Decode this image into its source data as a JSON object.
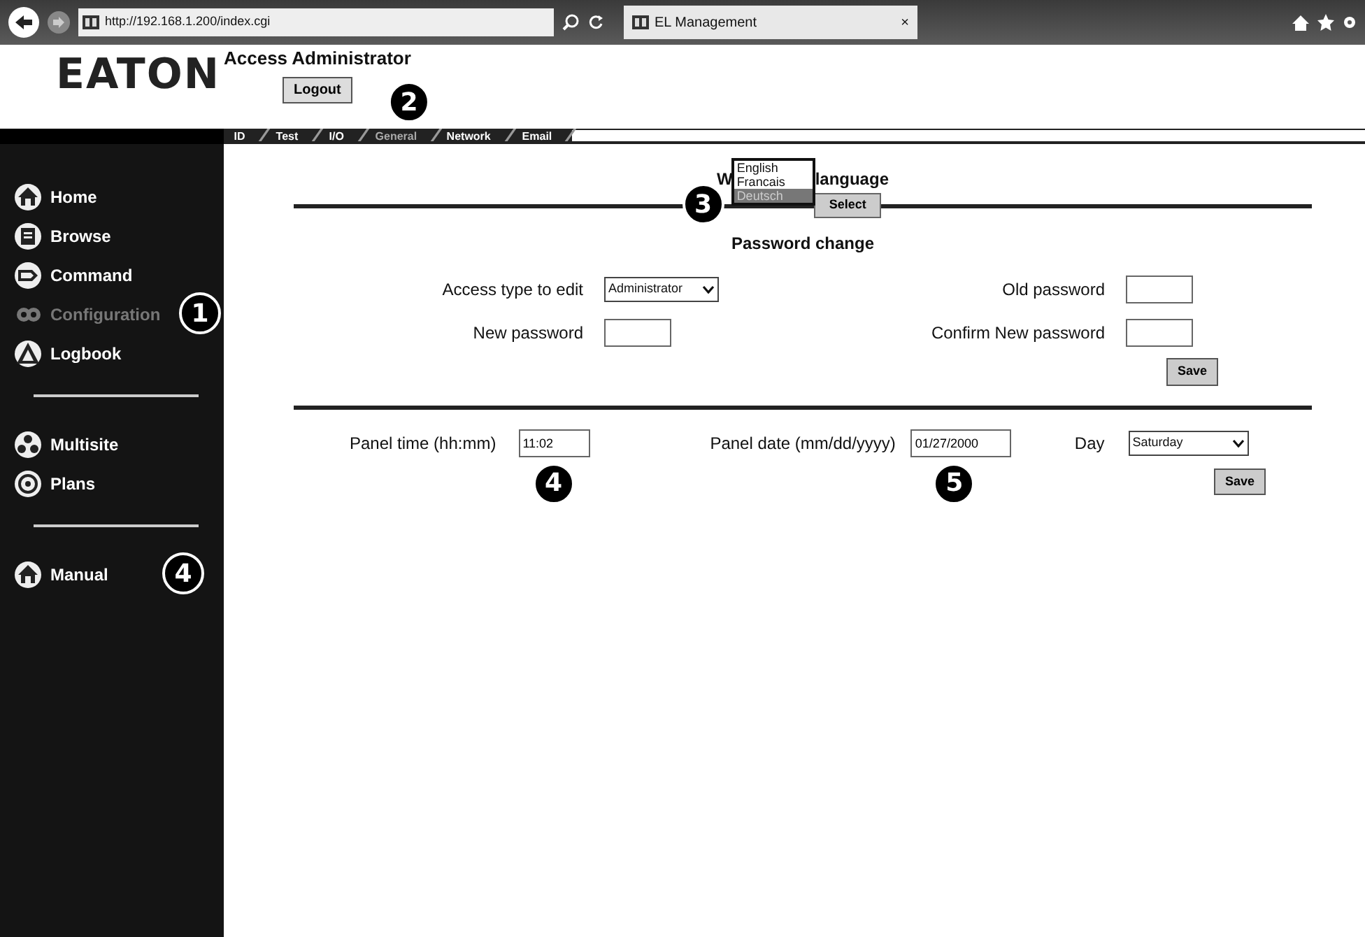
{
  "browser": {
    "address": "http://192.168.1.200/index.cgi",
    "tab_title": "EL Management",
    "tab_close": "×"
  },
  "header": {
    "logo": "EATON",
    "user_title": "Access Administrator",
    "logout": "Logout"
  },
  "tabs": [
    {
      "label": "ID",
      "selected": false
    },
    {
      "label": "Test",
      "selected": false
    },
    {
      "label": "I/O",
      "selected": false
    },
    {
      "label": "General",
      "selected": true,
      "callout": "2"
    },
    {
      "label": "Network",
      "selected": false
    },
    {
      "label": "Email",
      "selected": false
    }
  ],
  "sidebar": {
    "groups": [
      {
        "items": [
          {
            "label": "Home",
            "selected": false
          },
          {
            "label": "Browse",
            "selected": false
          },
          {
            "label": "Command",
            "selected": false
          },
          {
            "label": "Configuration",
            "selected": true,
            "callout": "1"
          },
          {
            "label": "Logbook",
            "selected": false
          }
        ]
      },
      {
        "items": [
          {
            "label": "Multisite",
            "selected": false
          },
          {
            "label": "Plans",
            "selected": false
          }
        ]
      },
      {
        "items": [
          {
            "label": "Manual",
            "selected": false,
            "callout": "4"
          }
        ]
      }
    ]
  },
  "language": {
    "heading_start": "W",
    "heading_end": "language",
    "options": [
      {
        "label": "English",
        "selected": false
      },
      {
        "label": "Francais",
        "selected": false
      },
      {
        "label": "Deutsch",
        "selected": true
      }
    ],
    "select_button": "Select",
    "callout": "3"
  },
  "password": {
    "title": "Password change",
    "access_label": "Access type to edit",
    "access_value": "Administrator",
    "old_label": "Old password",
    "new_label": "New password",
    "confirm_label": "Confirm New password",
    "save": "Save"
  },
  "panel": {
    "time_label": "Panel time (hh:mm)",
    "time_value": "11:02",
    "time_callout": "4",
    "date_label": "Panel date (mm/dd/yyyy)",
    "date_value": "01/27/2000",
    "date_callout": "5",
    "day_label": "Day",
    "day_value": "Saturday",
    "save": "Save"
  }
}
